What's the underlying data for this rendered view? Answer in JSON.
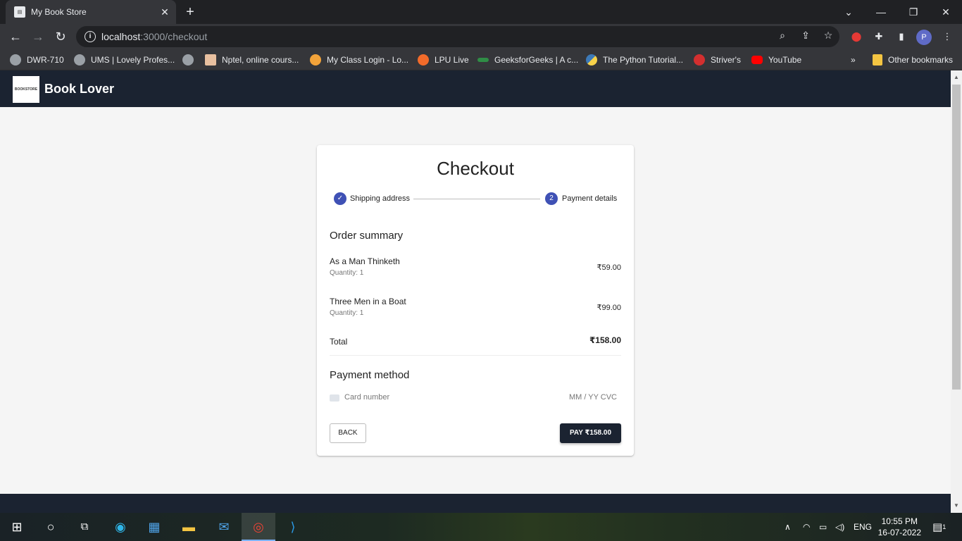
{
  "browser": {
    "tab_title": "My Book Store",
    "url_host": "localhost",
    "url_path": ":3000/checkout",
    "profile_initial": "P",
    "bookmarks": [
      {
        "label": "DWR-710",
        "color": "#9aa0a6"
      },
      {
        "label": "UMS | Lovely Profes...",
        "color": "#9aa0a6"
      },
      {
        "label": "",
        "color": "#9aa0a6"
      },
      {
        "label": "Nptel, online cours...",
        "color": "#e8c0a0"
      },
      {
        "label": "My Class Login - Lo...",
        "color": "#f2a33a"
      },
      {
        "label": "LPU Live",
        "color": "#f26b2a"
      },
      {
        "label": "GeeksforGeeks | A c...",
        "color": "#2f8d46"
      },
      {
        "label": "The Python Tutorial...",
        "color": "#3d7ab8"
      },
      {
        "label": "Striver's",
        "color": "#d32f2f"
      },
      {
        "label": "YouTube",
        "color": "#ff0000"
      }
    ],
    "overflow": "»",
    "other_bookmarks": "Other bookmarks"
  },
  "app": {
    "brand": "Book Lover",
    "logo_text": "BOOKSTORE"
  },
  "checkout": {
    "title": "Checkout",
    "steps": [
      {
        "label": "Shipping address",
        "state": "completed",
        "icon": "✓"
      },
      {
        "label": "Payment details",
        "state": "active",
        "icon": "2"
      }
    ],
    "order_summary_title": "Order summary",
    "items": [
      {
        "name": "As a Man Thinketh",
        "quantity": "Quantity: 1",
        "price": "₹59.00"
      },
      {
        "name": "Three Men in a Boat",
        "quantity": "Quantity: 1",
        "price": "₹99.00"
      }
    ],
    "total_label": "Total",
    "total_value": "₹158.00",
    "payment_method_title": "Payment method",
    "card_placeholder": "Card number",
    "expiry_cvc_placeholder": "MM / YY  CVC",
    "back_label": "BACK",
    "pay_label": "PAY ₹158.00"
  },
  "taskbar": {
    "language": "ENG",
    "time": "10:55 PM",
    "date": "16-07-2022",
    "notification_count": "1"
  }
}
